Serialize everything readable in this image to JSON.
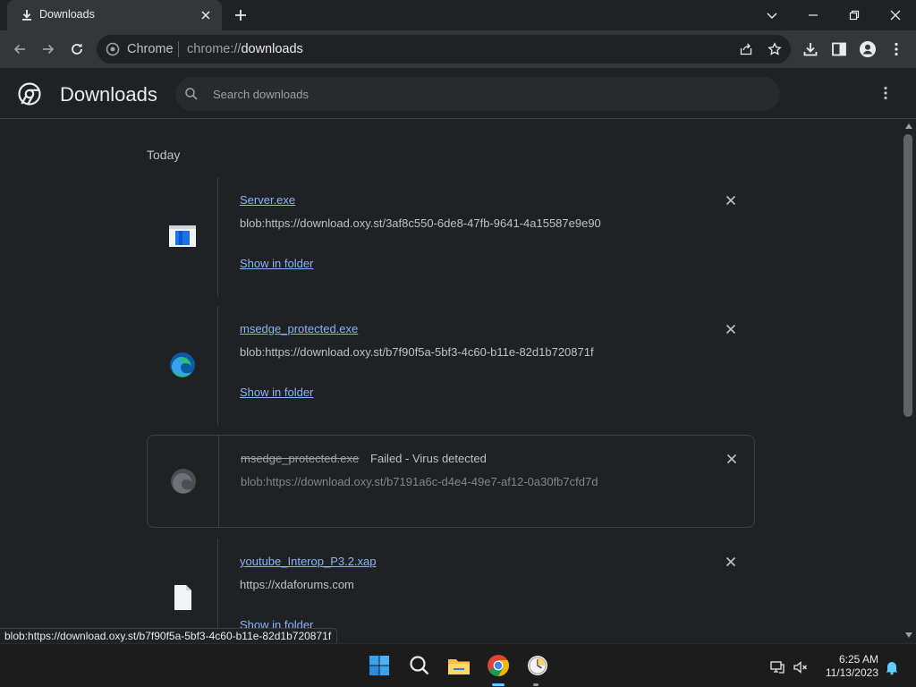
{
  "window": {
    "tab_title": "Downloads",
    "icons": [
      "download-icon",
      "close-icon",
      "plus-icon",
      "chevron-down-icon",
      "minimize-icon",
      "restore-icon",
      "close-icon"
    ]
  },
  "toolbar": {
    "omnibox_label": "Chrome",
    "url_scheme": "chrome://",
    "url_host": "downloads",
    "icons": [
      "back-icon",
      "forward-icon",
      "reload-icon",
      "share-icon",
      "star-icon",
      "download-icon",
      "side-panel-icon",
      "profile-icon",
      "menu-icon"
    ]
  },
  "header": {
    "title": "Downloads",
    "search_placeholder": "Search downloads"
  },
  "downloads": {
    "date_label": "Today",
    "items": [
      {
        "name": "Server.exe",
        "url": "blob:https://download.oxy.st/3af8c550-6de8-47fb-9641-4a15587e9e90",
        "action": "Show in folder",
        "icon": "exe-file-icon"
      },
      {
        "name": "msedge_protected.exe",
        "url": "blob:https://download.oxy.st/b7f90f5a-5bf3-4c60-b11e-82d1b720871f",
        "action": "Show in folder",
        "icon": "edge-icon"
      },
      {
        "name": "msedge_protected.exe",
        "status": "Failed - Virus detected",
        "url": "blob:https://download.oxy.st/b7191a6c-d4e4-49e7-af12-0a30fb7cfd7d",
        "icon": "edge-icon"
      },
      {
        "name": "youtube_Interop_P3.2.xap",
        "url": "https://xdaforums.com",
        "action": "Show in folder",
        "icon": "file-icon"
      }
    ]
  },
  "status_bar": {
    "link_preview": "blob:https://download.oxy.st/b7f90f5a-5bf3-4c60-b11e-82d1b720871f"
  },
  "taskbar": {
    "time": "6:25 AM",
    "date": "11/13/2023",
    "apps": [
      "windows-start-icon",
      "search-icon",
      "file-explorer-icon",
      "chrome-icon",
      "clock-app-icon"
    ]
  },
  "colors": {
    "background": "#202124",
    "toolbar": "#35363a",
    "link": "#8ab4f8",
    "text": "#e8eaed",
    "muted": "#bdc1c6",
    "accent": "#60cdff"
  }
}
